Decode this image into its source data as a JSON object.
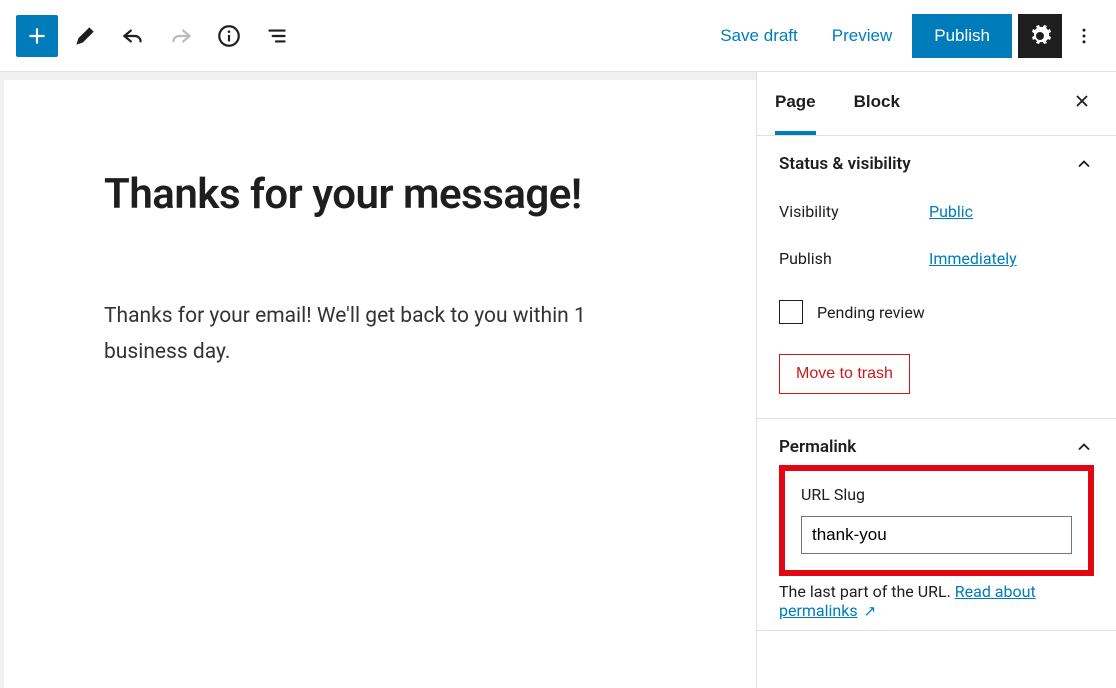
{
  "toolbar": {
    "save_draft": "Save draft",
    "preview": "Preview",
    "publish": "Publish"
  },
  "editor": {
    "title": "Thanks for your message!",
    "body": "Thanks for your email! We'll get back to you within 1 business day."
  },
  "sidebar": {
    "tabs": {
      "page": "Page",
      "block": "Block"
    },
    "status_visibility": {
      "title": "Status & visibility",
      "visibility_label": "Visibility",
      "visibility_value": "Public",
      "publish_label": "Publish",
      "publish_value": "Immediately",
      "pending_review": "Pending review",
      "move_to_trash": "Move to trash"
    },
    "permalink": {
      "title": "Permalink",
      "url_slug_label": "URL Slug",
      "url_slug_value": "thank-you",
      "help_prefix": "The last part of the URL. ",
      "help_link": "Read about permalinks"
    }
  }
}
